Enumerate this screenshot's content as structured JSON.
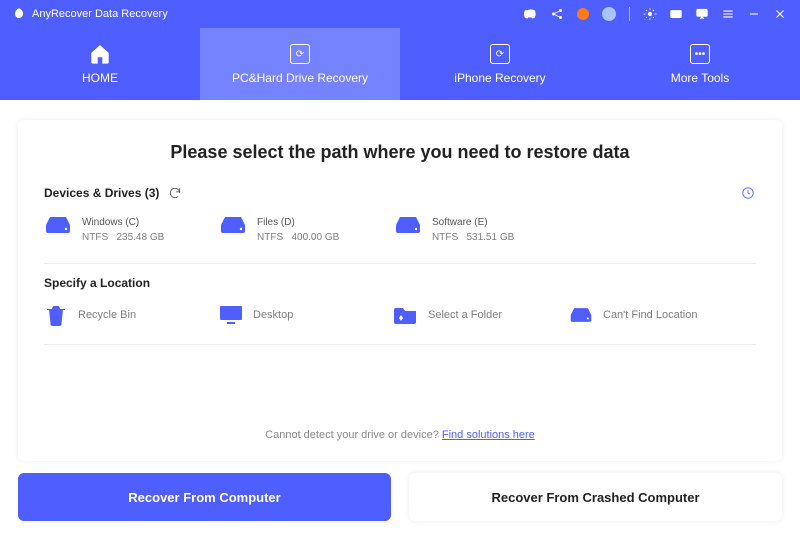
{
  "app": {
    "title": "AnyRecover Data Recovery"
  },
  "nav": {
    "tabs": [
      {
        "label": "HOME"
      },
      {
        "label": "PC&Hard Drive Recovery"
      },
      {
        "label": "iPhone Recovery"
      },
      {
        "label": "More Tools"
      }
    ]
  },
  "main": {
    "headline": "Please select the path where you need to restore data",
    "devices_section": {
      "title": "Devices & Drives (3)"
    },
    "drives": [
      {
        "name": "Windows (C)",
        "fs": "NTFS",
        "size": "235.48 GB"
      },
      {
        "name": "Files (D)",
        "fs": "NTFS",
        "size": "400.00 GB"
      },
      {
        "name": "Software (E)",
        "fs": "NTFS",
        "size": "531.51 GB"
      }
    ],
    "locations_section": {
      "title": "Specify a Location"
    },
    "locations": [
      {
        "label": "Recycle Bin"
      },
      {
        "label": "Desktop"
      },
      {
        "label": "Select a Folder"
      },
      {
        "label": "Can't Find Location"
      }
    ],
    "hint": {
      "text": "Cannot detect your drive or device? ",
      "link": "Find solutions here"
    }
  },
  "buttons": {
    "primary": "Recover From Computer",
    "secondary": "Recover From Crashed Computer"
  }
}
